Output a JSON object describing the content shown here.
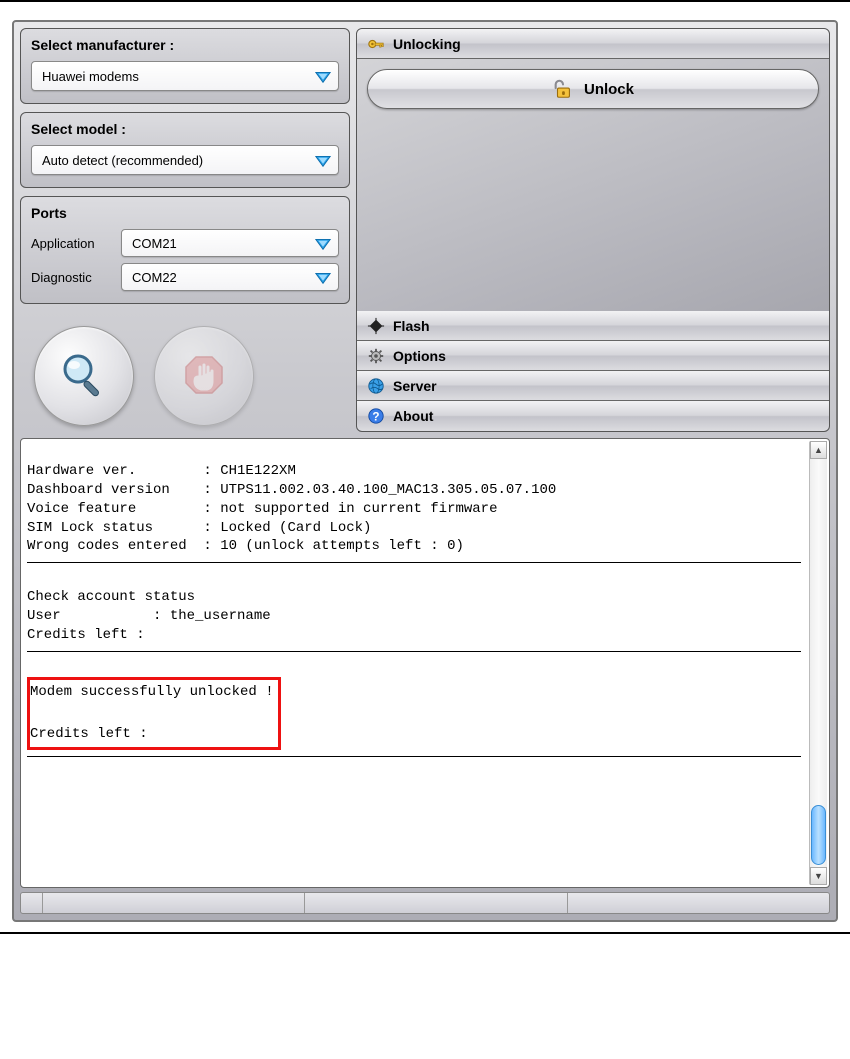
{
  "left": {
    "manufacturer_label": "Select manufacturer :",
    "manufacturer_value": "Huawei modems",
    "model_label": "Select model :",
    "model_value": "Auto detect (recommended)",
    "ports_label": "Ports",
    "ports": {
      "application_label": "Application",
      "application_value": "COM21",
      "diagnostic_label": "Diagnostic",
      "diagnostic_value": "COM22"
    }
  },
  "right": {
    "unlocking_header": "Unlocking",
    "unlock_button": "Unlock",
    "tabs": {
      "flash": "Flash",
      "options": "Options",
      "server": "Server",
      "about": "About"
    }
  },
  "log": {
    "line1": "Hardware ver.        : CH1E122XM",
    "line2": "Dashboard version    : UTPS11.002.03.40.100_MAC13.305.05.07.100",
    "line3": "Voice feature        : not supported in current firmware",
    "line4": "SIM Lock status      : Locked (Card Lock)",
    "line5": "Wrong codes entered  : 10 (unlock attempts left : 0)",
    "line6": "Check account status",
    "line7": "User           : the_username",
    "line8": "Credits left :",
    "highlight1": "Modem successfully unlocked !",
    "highlight2": "Credits left :"
  }
}
